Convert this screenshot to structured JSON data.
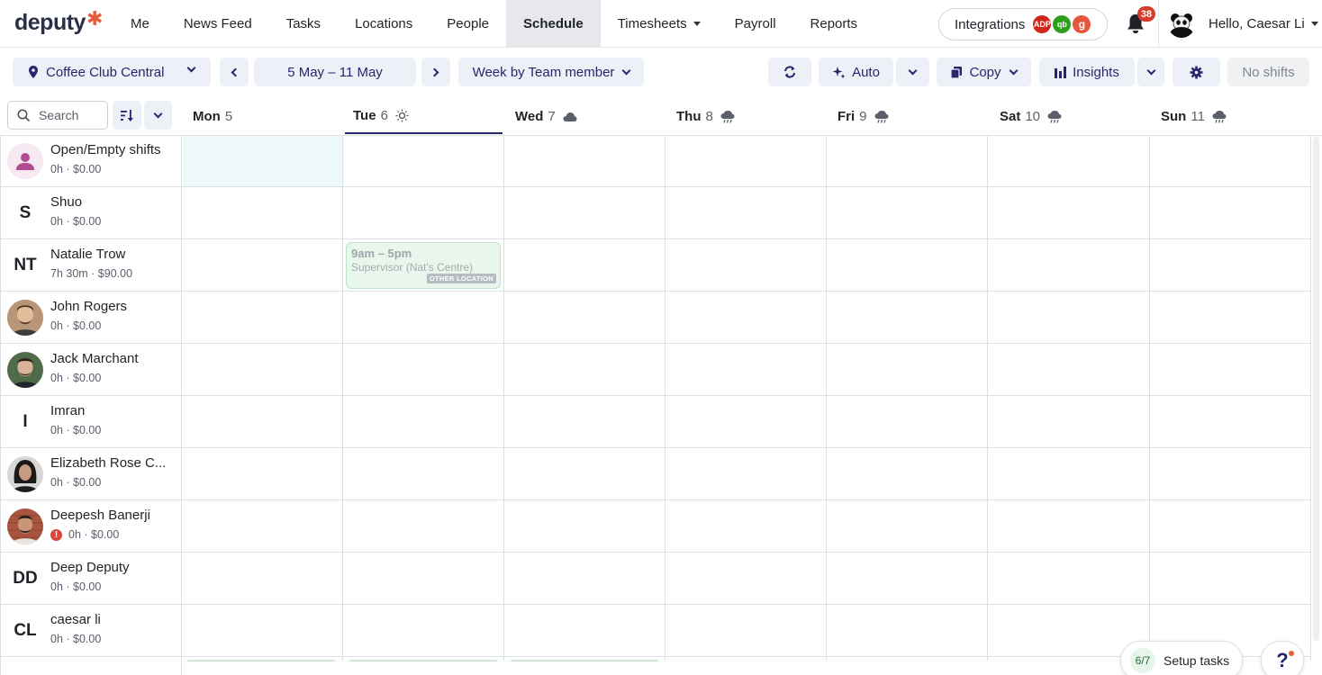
{
  "brand": {
    "name": "deputy",
    "mark": "✱"
  },
  "nav": {
    "items": [
      {
        "label": "Me"
      },
      {
        "label": "News Feed"
      },
      {
        "label": "Tasks"
      },
      {
        "label": "Locations"
      },
      {
        "label": "People"
      },
      {
        "label": "Schedule"
      },
      {
        "label": "Timesheets"
      },
      {
        "label": "Payroll"
      },
      {
        "label": "Reports"
      }
    ],
    "integrations_label": "Integrations",
    "integration_badges": [
      "ADP",
      "qb",
      "g"
    ],
    "notifications_count": "38",
    "greeting": "Hello, Caesar Li"
  },
  "toolbar": {
    "location": "Coffee Club Central",
    "date_range": "5 May – 11 May",
    "view": "Week by Team member",
    "auto_label": "Auto",
    "copy_label": "Copy",
    "insights_label": "Insights",
    "no_shifts_label": "No shifts"
  },
  "search": {
    "placeholder": "Search"
  },
  "days": [
    {
      "name": "Mon",
      "num": "5"
    },
    {
      "name": "Tue",
      "num": "6"
    },
    {
      "name": "Wed",
      "num": "7"
    },
    {
      "name": "Thu",
      "num": "8"
    },
    {
      "name": "Fri",
      "num": "9"
    },
    {
      "name": "Sat",
      "num": "10"
    },
    {
      "name": "Sun",
      "num": "11"
    }
  ],
  "employees": [
    {
      "name": "Open/Empty shifts",
      "meta": "0h · $0.00",
      "initials": ""
    },
    {
      "name": "Shuo",
      "meta": "0h · $0.00",
      "initials": "S"
    },
    {
      "name": "Natalie Trow",
      "meta": "7h 30m · $90.00",
      "initials": "NT"
    },
    {
      "name": "John Rogers",
      "meta": "0h · $0.00",
      "initials": ""
    },
    {
      "name": "Jack Marchant",
      "meta": "0h · $0.00",
      "initials": ""
    },
    {
      "name": "Imran",
      "meta": "0h · $0.00",
      "initials": "I"
    },
    {
      "name": "Elizabeth Rose C...",
      "meta": "0h · $0.00",
      "initials": ""
    },
    {
      "name": "Deepesh Banerji",
      "meta": "0h · $0.00",
      "initials": ""
    },
    {
      "name": "Deep Deputy",
      "meta": "0h · $0.00",
      "initials": "DD"
    },
    {
      "name": "caesar li",
      "meta": "0h · $0.00",
      "initials": "CL"
    }
  ],
  "shift": {
    "time": "9am – 5pm",
    "role": "Supervisor (Nat's Centre)",
    "tag": "OTHER LOCATION"
  },
  "setup_tasks": {
    "count": "6/7",
    "label": "Setup tasks"
  },
  "help": {
    "label": "?"
  }
}
